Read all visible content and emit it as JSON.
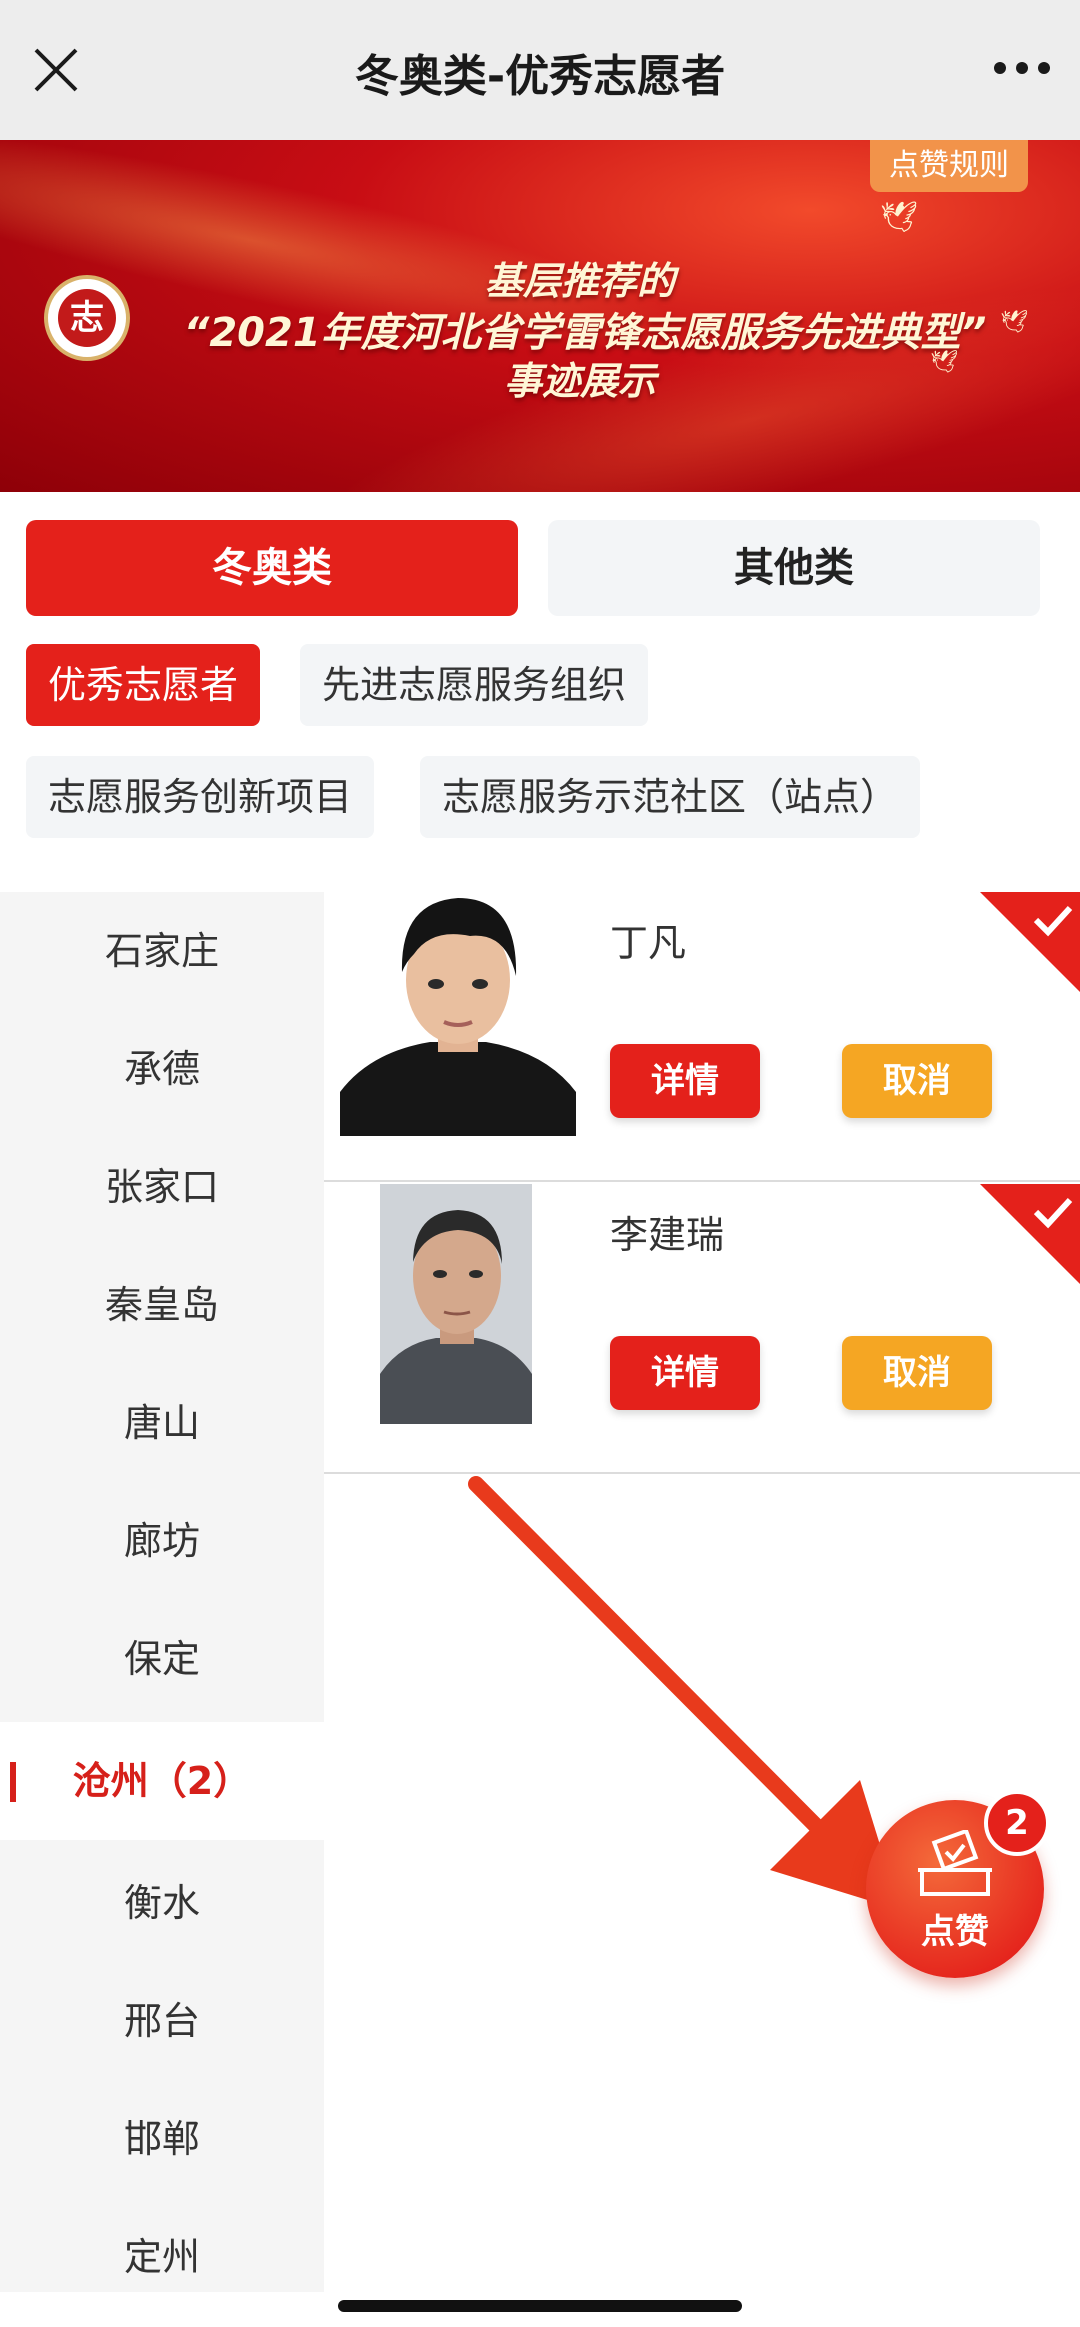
{
  "header": {
    "title": "冬奥类-优秀志愿者"
  },
  "banner": {
    "rules_label": "点赞规则",
    "logo_text": "志",
    "line1": "基层推荐的",
    "line2": "“2021年度河北省学雷锋志愿服务先进典型”",
    "line3": "事迹展示"
  },
  "categories": [
    {
      "label": "冬奥类",
      "active": true
    },
    {
      "label": "其他类",
      "active": false
    }
  ],
  "tags": [
    {
      "label": "优秀志愿者",
      "active": true
    },
    {
      "label": "先进志愿服务组织",
      "active": false
    },
    {
      "label": "志愿服务创新项目",
      "active": false
    },
    {
      "label": "志愿服务示范社区（站点）",
      "active": false
    }
  ],
  "sidebar": {
    "items": [
      {
        "label": "石家庄"
      },
      {
        "label": "承德"
      },
      {
        "label": "张家口"
      },
      {
        "label": "秦皇岛"
      },
      {
        "label": "唐山"
      },
      {
        "label": "廊坊"
      },
      {
        "label": "保定"
      },
      {
        "label": "沧州（2）",
        "active": true
      },
      {
        "label": "衡水"
      },
      {
        "label": "邢台"
      },
      {
        "label": "邯郸"
      },
      {
        "label": "定州"
      }
    ]
  },
  "volunteers": [
    {
      "name": "丁凡",
      "detail_label": "详情",
      "cancel_label": "取消",
      "selected": true
    },
    {
      "name": "李建瑞",
      "detail_label": "详情",
      "cancel_label": "取消",
      "selected": true
    }
  ],
  "vote": {
    "label": "点赞",
    "count": "2"
  },
  "colors": {
    "primary_red": "#e4211b",
    "orange": "#f5a623",
    "sidebar_bg": "#f5f5f5"
  }
}
